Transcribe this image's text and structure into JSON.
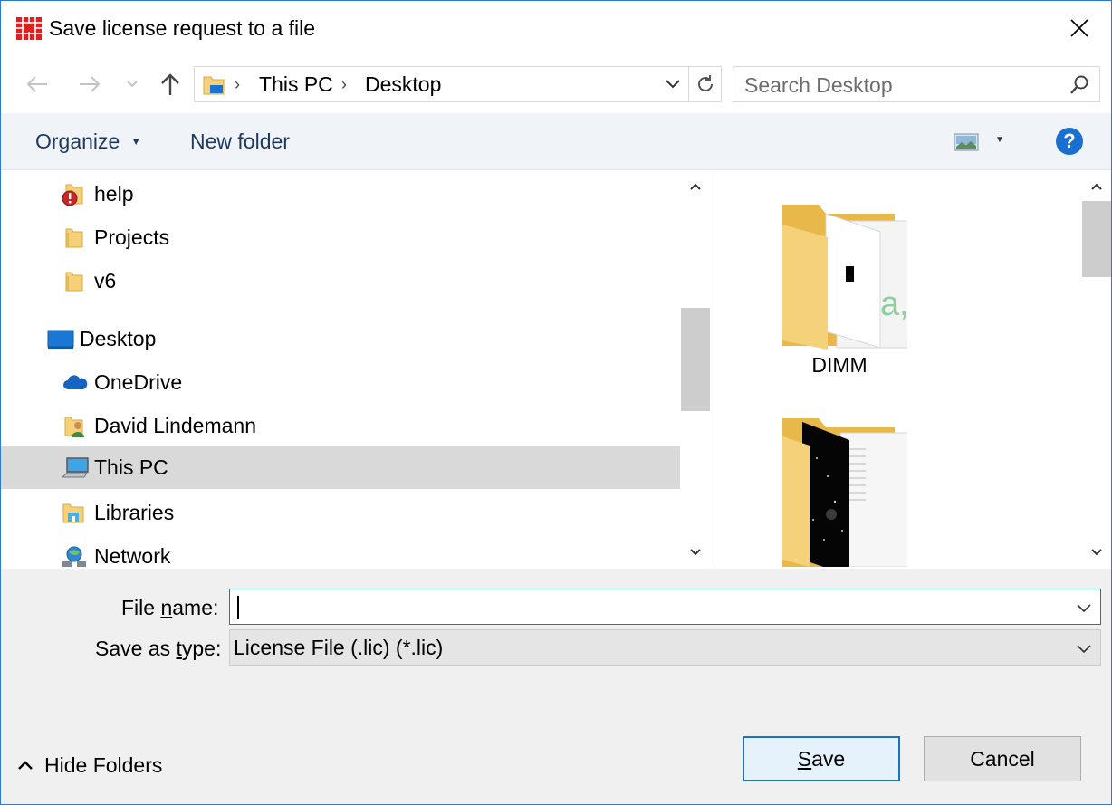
{
  "window": {
    "title": "Save license request to a file",
    "app_icon": "red-app-icon",
    "accent": "#2b79d0"
  },
  "address": {
    "crumbs": [
      "This PC",
      "Desktop"
    ],
    "search_placeholder": "Search Desktop"
  },
  "toolbar": {
    "organize_label": "Organize",
    "new_folder_label": "New folder",
    "help_label": "?"
  },
  "nav": {
    "items": [
      {
        "label": "help",
        "icon": "folder-warning-icon"
      },
      {
        "label": "Projects",
        "icon": "folder-icon"
      },
      {
        "label": "v6",
        "icon": "folder-icon"
      },
      {
        "label": "Desktop",
        "icon": "desktop-icon"
      },
      {
        "label": "OneDrive",
        "icon": "onedrive-cloud-icon"
      },
      {
        "label": "David Lindemann",
        "icon": "user-folder-icon"
      },
      {
        "label": "This PC",
        "icon": "computer-icon",
        "selected": true
      },
      {
        "label": "Libraries",
        "icon": "libraries-icon"
      },
      {
        "label": "Network",
        "icon": "network-icon"
      }
    ]
  },
  "content": {
    "items": [
      {
        "label": "DIMM",
        "icon": "folder-preview-icon"
      },
      {
        "label": "",
        "icon": "folder-preview-dark-icon"
      }
    ]
  },
  "form": {
    "file_name_label_pre": "File ",
    "file_name_label_ul": "n",
    "file_name_label_post": "ame:",
    "file_name_value": "",
    "save_type_label_pre": "Save as ",
    "save_type_label_ul": "t",
    "save_type_label_post": "ype:",
    "save_type_value": "License File (.lic) (*.lic)"
  },
  "footer": {
    "hide_folders_label": "Hide Folders",
    "save_ul": "S",
    "save_rest": "ave",
    "cancel_label": "Cancel"
  },
  "colors": {
    "toolbar_bg": "#f0f4f9",
    "selected_bg": "#d9d9d9",
    "bottom_bg": "#f0f0f0",
    "primary_border": "#1a73c7"
  }
}
